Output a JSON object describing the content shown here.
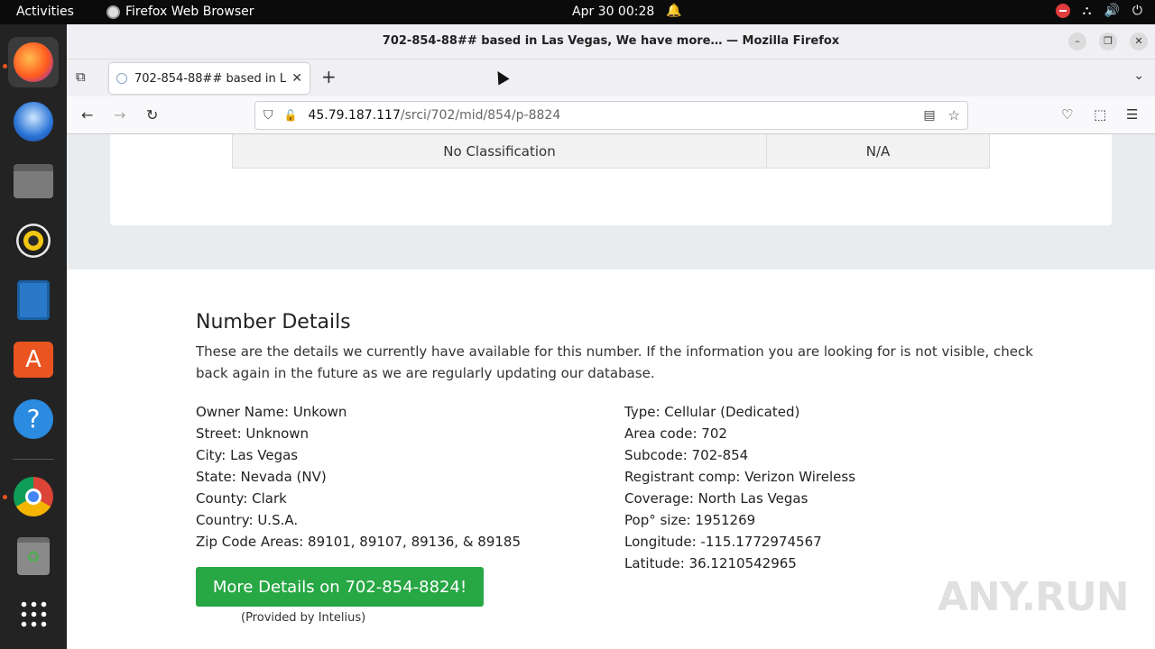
{
  "topbar": {
    "activities": "Activities",
    "app_name": "Firefox Web Browser",
    "clock": "Apr 30  00:28"
  },
  "window": {
    "title": "702-854-88## based in Las Vegas, We have more… — Mozilla Firefox"
  },
  "tab": {
    "title": "702-854-88## based in Las Vegas"
  },
  "url": {
    "host": "45.79.187.117",
    "path": "/srci/702/mid/854/p-8824"
  },
  "table_row": {
    "classification": "No Classification",
    "value": "N/A"
  },
  "details": {
    "heading": "Number Details",
    "description": "These are the details we currently have available for this number. If the information you are looking for is not visible, check back again in the future as we are regularly updating our database.",
    "left": [
      "Owner Name: Unkown",
      "Street: Unknown",
      "City: Las Vegas",
      "State: Nevada (NV)",
      "County: Clark",
      "Country: U.S.A.",
      "Zip Code Areas: 89101, 89107, 89136, & 89185"
    ],
    "right": [
      "Type: Cellular (Dedicated)",
      "Area code: 702",
      "Subcode: 702-854",
      "Registrant comp: Verizon Wireless",
      "Coverage: North Las Vegas",
      "Pop° size: 1951269",
      "Longitude: -115.1772974567",
      "Latitude: 36.1210542965"
    ],
    "more_button": "More Details on 702-854-8824!",
    "provided": "(Provided by Intelius)"
  },
  "watermark": "ANY.RUN",
  "colors": {
    "button_green": "#28a745",
    "gray_section": "#e9ecef",
    "ubuntu_orange": "#e95420"
  },
  "dock_icons": [
    "firefox-icon",
    "thunderbird-icon",
    "files-icon",
    "rhythmbox-icon",
    "writer-icon",
    "software-icon",
    "help-icon",
    "chrome-icon",
    "trash-icon",
    "app-grid-icon"
  ]
}
